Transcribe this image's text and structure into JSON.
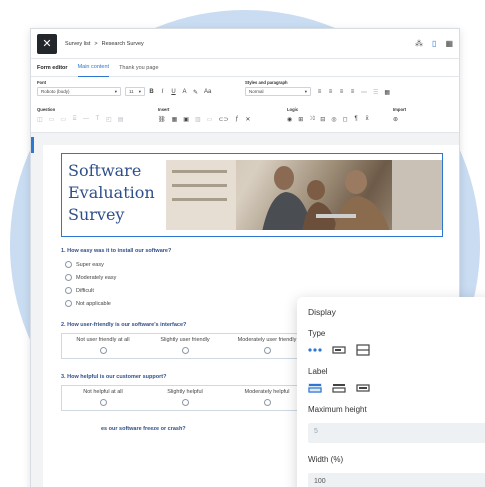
{
  "colors": {
    "accent": "#2e77d0",
    "title_blue": "#2f4f8a",
    "circle_bg": "#c9dcf2"
  },
  "breadcrumb": {
    "parent": "Survey list",
    "separator": ">",
    "current": "Research Survey"
  },
  "toolbar_icons": [
    "network-icon",
    "clipboard-icon",
    "grid-icon"
  ],
  "tabs": {
    "title": "Form editor",
    "items": [
      "Main content",
      "Thank you page"
    ]
  },
  "ribbon": {
    "font_label": "Font",
    "font_value": "Roboto (body)",
    "font_size": "11",
    "styles_label": "Styles and paragraph",
    "style_value": "Normal",
    "question_label": "Question",
    "insert_label": "Insert",
    "logic_label": "Logic",
    "import_label": "Import",
    "format_buttons": [
      "B",
      "I",
      "U",
      "A",
      "✎",
      "Aa"
    ],
    "align_buttons": [
      "≡",
      "≡",
      "≡",
      "≡",
      "⋯"
    ],
    "list_buttons": [
      "☰",
      "▦"
    ]
  },
  "banner": {
    "title": "Software Evaluation Survey"
  },
  "questions": [
    {
      "text": "1. How easy was it to install our software?",
      "options": [
        "Super easy",
        "Moderately easy",
        "Difficult",
        "Not applicable"
      ]
    },
    {
      "text": "2. How user-friendly is our software's interface?",
      "scale": [
        "Not user friendly at all",
        "Slightly user friendly",
        "Moderately user friendly"
      ]
    },
    {
      "text": "3. How helpful is our customer support?",
      "scale": [
        "Not helpful at all",
        "Slightly helpful",
        "Moderately helpful"
      ]
    },
    {
      "text": "es our software freeze or crash?"
    }
  ],
  "panel": {
    "title": "Display",
    "type_label": "Type",
    "type_icons": [
      "dots-icon",
      "single-line-icon",
      "multi-line-icon"
    ],
    "label_label": "Label",
    "label_icons": [
      "label-top-icon",
      "label-left-icon",
      "label-inside-icon"
    ],
    "max_height_label": "Maximum height",
    "max_height_value": "5",
    "width_label": "Width (%)",
    "width_value": "100"
  }
}
